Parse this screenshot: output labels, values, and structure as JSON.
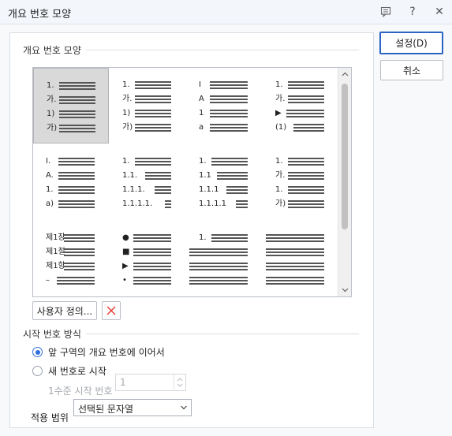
{
  "window": {
    "title": "개요 번호 모양",
    "feedback_icon": "comment-icon",
    "help_label": "?",
    "close_label": "✕"
  },
  "main": {
    "section_title": "개요 번호 모양",
    "grid": [
      {
        "selected": true,
        "labels": [
          "1.",
          "가.",
          "1)",
          "가)"
        ]
      },
      {
        "selected": false,
        "labels": [
          "1.",
          "가.",
          "1)",
          "가)"
        ]
      },
      {
        "selected": false,
        "labels": [
          "I",
          "A",
          "1",
          "a"
        ]
      },
      {
        "selected": false,
        "labels": [
          "1.",
          "가.",
          "▶",
          "(1)"
        ]
      },
      {
        "selected": false,
        "labels": [
          "I.",
          "A.",
          "1.",
          "a)"
        ]
      },
      {
        "selected": false,
        "labels": [
          "1.",
          "1.1.",
          "1.1.1.",
          "1.1.1.1."
        ]
      },
      {
        "selected": false,
        "labels": [
          "1.",
          "1.1",
          "1.1.1",
          "1.1.1.1"
        ]
      },
      {
        "selected": false,
        "labels": [
          "1.",
          "가.",
          "1.",
          "가)"
        ]
      },
      {
        "selected": false,
        "labels": [
          "제1장",
          "제1절",
          "제1항",
          "–"
        ]
      },
      {
        "selected": false,
        "labels": [
          "●",
          "■",
          "▶",
          "•"
        ]
      },
      {
        "selected": false,
        "labels": [
          "1.",
          "",
          "",
          ""
        ]
      },
      {
        "selected": false,
        "labels": [
          "",
          "",
          "",
          ""
        ]
      }
    ],
    "custom_button": "사용자 정의...",
    "delete_icon": "delete-x-icon",
    "start_section_title": "시작 번호 방식",
    "radio_continue": "앞 구역의 개요 번호에 이어서",
    "radio_new": "새 번호로 시작",
    "level1_label": "1수준 시작 번호",
    "level1_value": "1",
    "apply_label": "적용 범위",
    "apply_value": "선택된 문자열"
  },
  "actions": {
    "ok": "설정(D)",
    "cancel": "취소"
  },
  "colors": {
    "accent": "#2b64c5",
    "delete_x": "#e8392f",
    "selected_cell": "#d9d9d9"
  }
}
